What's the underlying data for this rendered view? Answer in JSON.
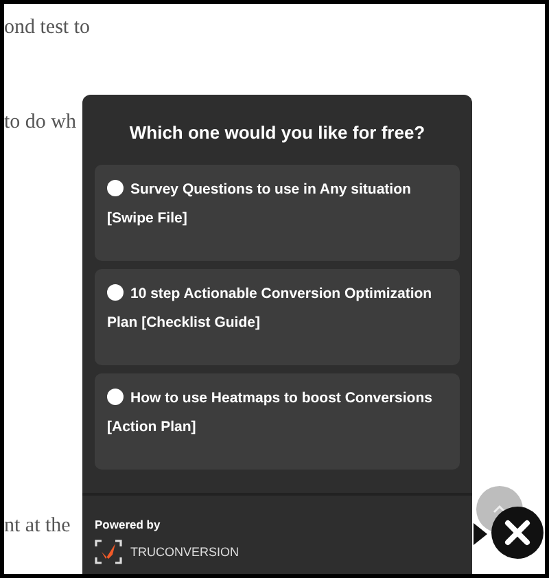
{
  "article": {
    "lines": [
      "ond test to",
      "to do wh",
      "nt at the"
    ]
  },
  "popup": {
    "title": "Which one would you like for free?",
    "options": [
      {
        "label": "Survey Questions to use in Any situation [Swipe File]",
        "selected": false
      },
      {
        "label": "10 step Actionable Conversion Optimization Plan [Checklist Guide]",
        "selected": false
      },
      {
        "label": "How to use Heatmaps to boost Conversions [Action Plan]",
        "selected": false
      }
    ],
    "powered_by": "Powered by",
    "brand": "TRUCONVERSION"
  }
}
